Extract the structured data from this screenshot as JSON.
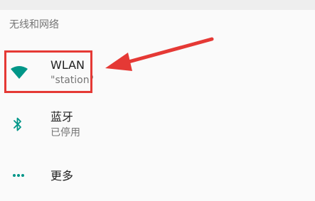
{
  "section": {
    "title": "无线和网络"
  },
  "items": [
    {
      "title": "WLAN",
      "subtitle": "\"station\"",
      "icon": "wifi-icon"
    },
    {
      "title": "蓝牙",
      "subtitle": "已停用",
      "icon": "bluetooth-icon"
    },
    {
      "title": "更多",
      "icon": "more-horiz-icon"
    }
  ],
  "colors": {
    "accent": "#009688",
    "annotation": "#e53935",
    "background": "#fafafa"
  }
}
